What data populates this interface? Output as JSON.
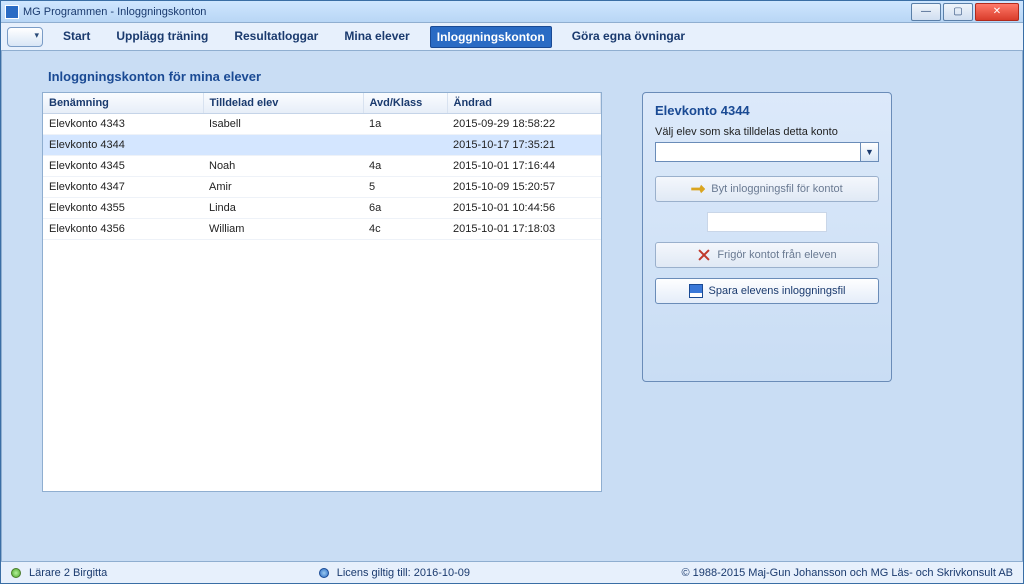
{
  "window": {
    "title": "MG Programmen - Inloggningskonton"
  },
  "menu": {
    "items": [
      "Start",
      "Upplägg träning",
      "Resultatloggar",
      "Mina elever",
      "Inloggningskonton",
      "Göra egna övningar"
    ],
    "active_index": 4
  },
  "page": {
    "heading": "Inloggningskonton för mina elever"
  },
  "table": {
    "columns": [
      "Benämning",
      "Tilldelad elev",
      "Avd/Klass",
      "Ändrad"
    ],
    "rows": [
      {
        "konto": "Elevkonto 4343",
        "elev": "Isabell",
        "klass": "1a",
        "andrad": "2015-09-29 18:58:22",
        "selected": false
      },
      {
        "konto": "Elevkonto 4344",
        "elev": "",
        "klass": "",
        "andrad": "2015-10-17 17:35:21",
        "selected": true
      },
      {
        "konto": "Elevkonto 4345",
        "elev": "Noah",
        "klass": "4a",
        "andrad": "2015-10-01 17:16:44",
        "selected": false
      },
      {
        "konto": "Elevkonto 4347",
        "elev": "Amir",
        "klass": "5",
        "andrad": "2015-10-09 15:20:57",
        "selected": false
      },
      {
        "konto": "Elevkonto 4355",
        "elev": "Linda",
        "klass": "6a",
        "andrad": "2015-10-01 10:44:56",
        "selected": false
      },
      {
        "konto": "Elevkonto 4356",
        "elev": "William",
        "klass": "4c",
        "andrad": "2015-10-01 17:18:03",
        "selected": false
      }
    ]
  },
  "panel": {
    "title": "Elevkonto 4344",
    "instruction": "Välj elev som ska tilldelas detta konto",
    "dropdown_value": "",
    "btn_change_file": "Byt inloggningsfil för kontot",
    "btn_release": "Frigör kontot från eleven",
    "btn_save": "Spara elevens inloggningsfil"
  },
  "status": {
    "user": "Lärare 2 Birgitta",
    "licence": "Licens giltig till: 2016-10-09",
    "copyright": "© 1988-2015 Maj-Gun Johansson och MG Läs- och Skrivkonsult AB"
  }
}
